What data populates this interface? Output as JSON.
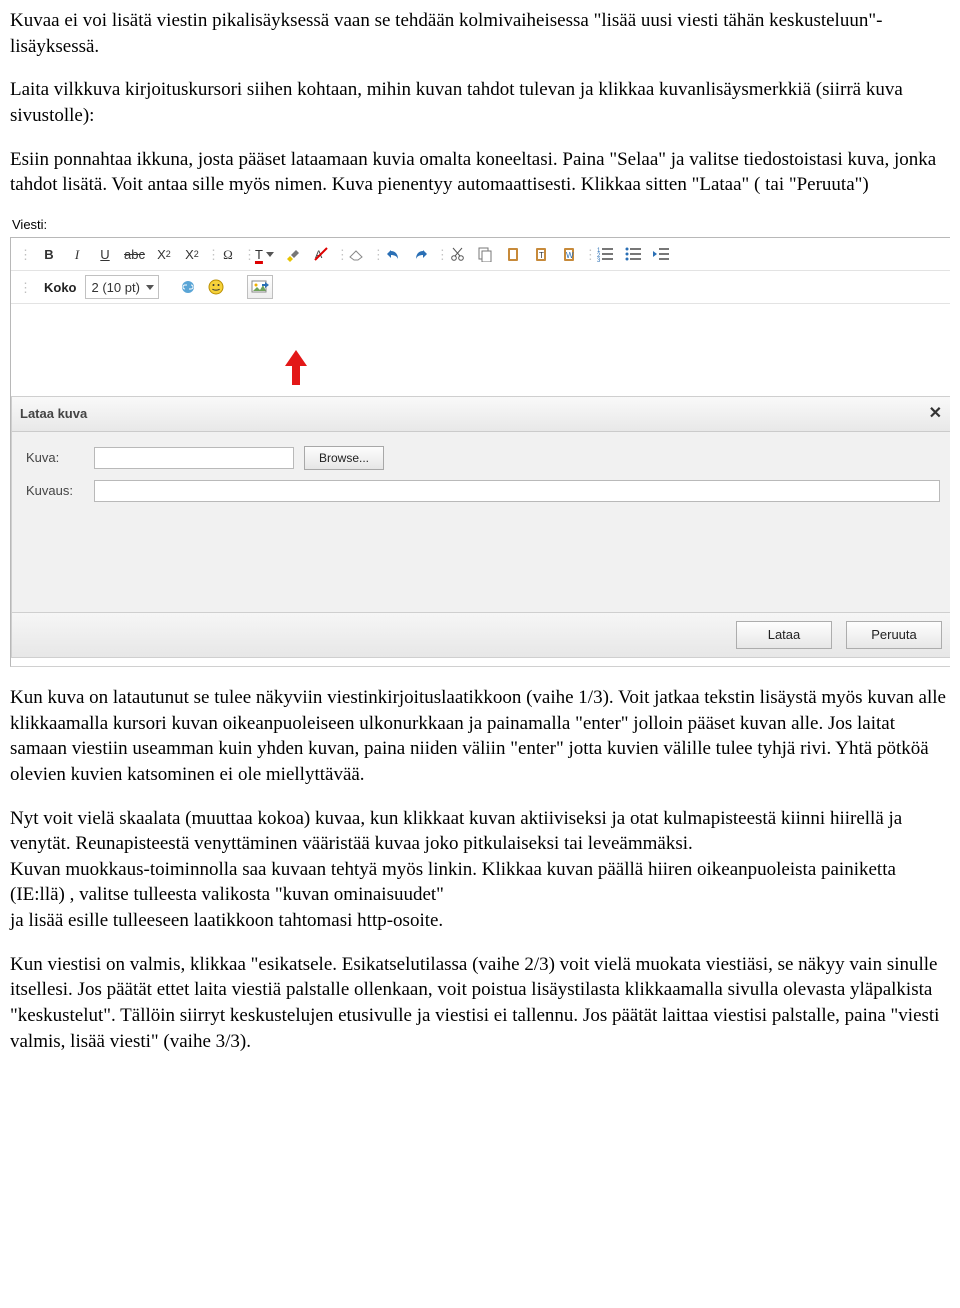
{
  "paragraphs": {
    "p1": "Kuvaa ei voi lisätä viestin pikalisäyksessä vaan se tehdään kolmivaiheisessa \"lisää uusi viesti tähän keskusteluun\"-lisäyksessä.",
    "p2": "Laita vilkkuva kirjoituskursori siihen kohtaan, mihin kuvan tahdot tulevan ja klikkaa kuvanlisäysmerkkiä (siirrä kuva sivustolle):",
    "p3": "Esiin ponnahtaa ikkuna, josta pääset lataamaan kuvia omalta koneeltasi. Paina \"Selaa\" ja valitse tiedostoistasi kuva, jonka tahdot lisätä. Voit antaa sille myös nimen. Kuva pienentyy automaattisesti. Klikkaa sitten \"Lataa\" ( tai \"Peruuta\")",
    "p4": "Kun kuva on latautunut se tulee näkyviin viestinkirjoituslaatikkoon (vaihe 1/3). Voit jatkaa tekstin lisäystä myös kuvan alle klikkaamalla  kursori kuvan oikeanpuoleiseen ulkonurkkaan ja painamalla \"enter\" jolloin pääset kuvan alle. Jos laitat samaan viestiin useamman kuin yhden kuvan, paina niiden väliin \"enter\" jotta kuvien välille tulee tyhjä rivi. Yhtä pötköä olevien kuvien katsominen ei ole miellyttävää.",
    "p5": "Nyt voit vielä skaalata (muuttaa kokoa) kuvaa, kun klikkaat kuvan aktiiviseksi ja otat kulmapisteestä kiinni hiirellä ja venytät. Reunapisteestä venyttäminen vääristää kuvaa joko pitkulaiseksi tai leveämmäksi.\nKuvan muokkaus-toiminnolla saa kuvaan tehtyä myös linkin. Klikkaa kuvan päällä hiiren oikeanpuoleista painiketta (IE:llä) , valitse tulleesta valikosta \"kuvan ominaisuudet\"\nja lisää esille tulleeseen laatikkoon tahtomasi http-osoite.",
    "p6": "Kun viestisi on valmis, klikkaa \"esikatsele. Esikatselutilassa (vaihe 2/3) voit vielä muokata viestiäsi, se näkyy vain sinulle itsellesi. Jos päätät ettet laita viestiä palstalle ollenkaan, voit poistua lisäystilasta klikkaamalla sivulla olevasta yläpalkista \"keskustelut\". Tällöin siirryt keskustelujen etusivulle ja viestisi ei tallennu.  Jos päätät laittaa viestisi palstalle, paina \"viesti valmis, lisää viesti\" (vaihe 3/3)."
  },
  "editor": {
    "field_label": "Viesti:",
    "size_label": "Koko",
    "size_value": "2 (10 pt)"
  },
  "icons": {
    "bold": "B",
    "italic": "I",
    "underline": "U",
    "strike": "abc",
    "sub": "X",
    "sup": "X",
    "omega": "Ω",
    "Tcolor": "T"
  },
  "modal": {
    "title": "Lataa kuva",
    "field_image": "Kuva:",
    "field_desc": "Kuvaus:",
    "browse": "Browse...",
    "ok": "Lataa",
    "cancel": "Peruuta"
  }
}
